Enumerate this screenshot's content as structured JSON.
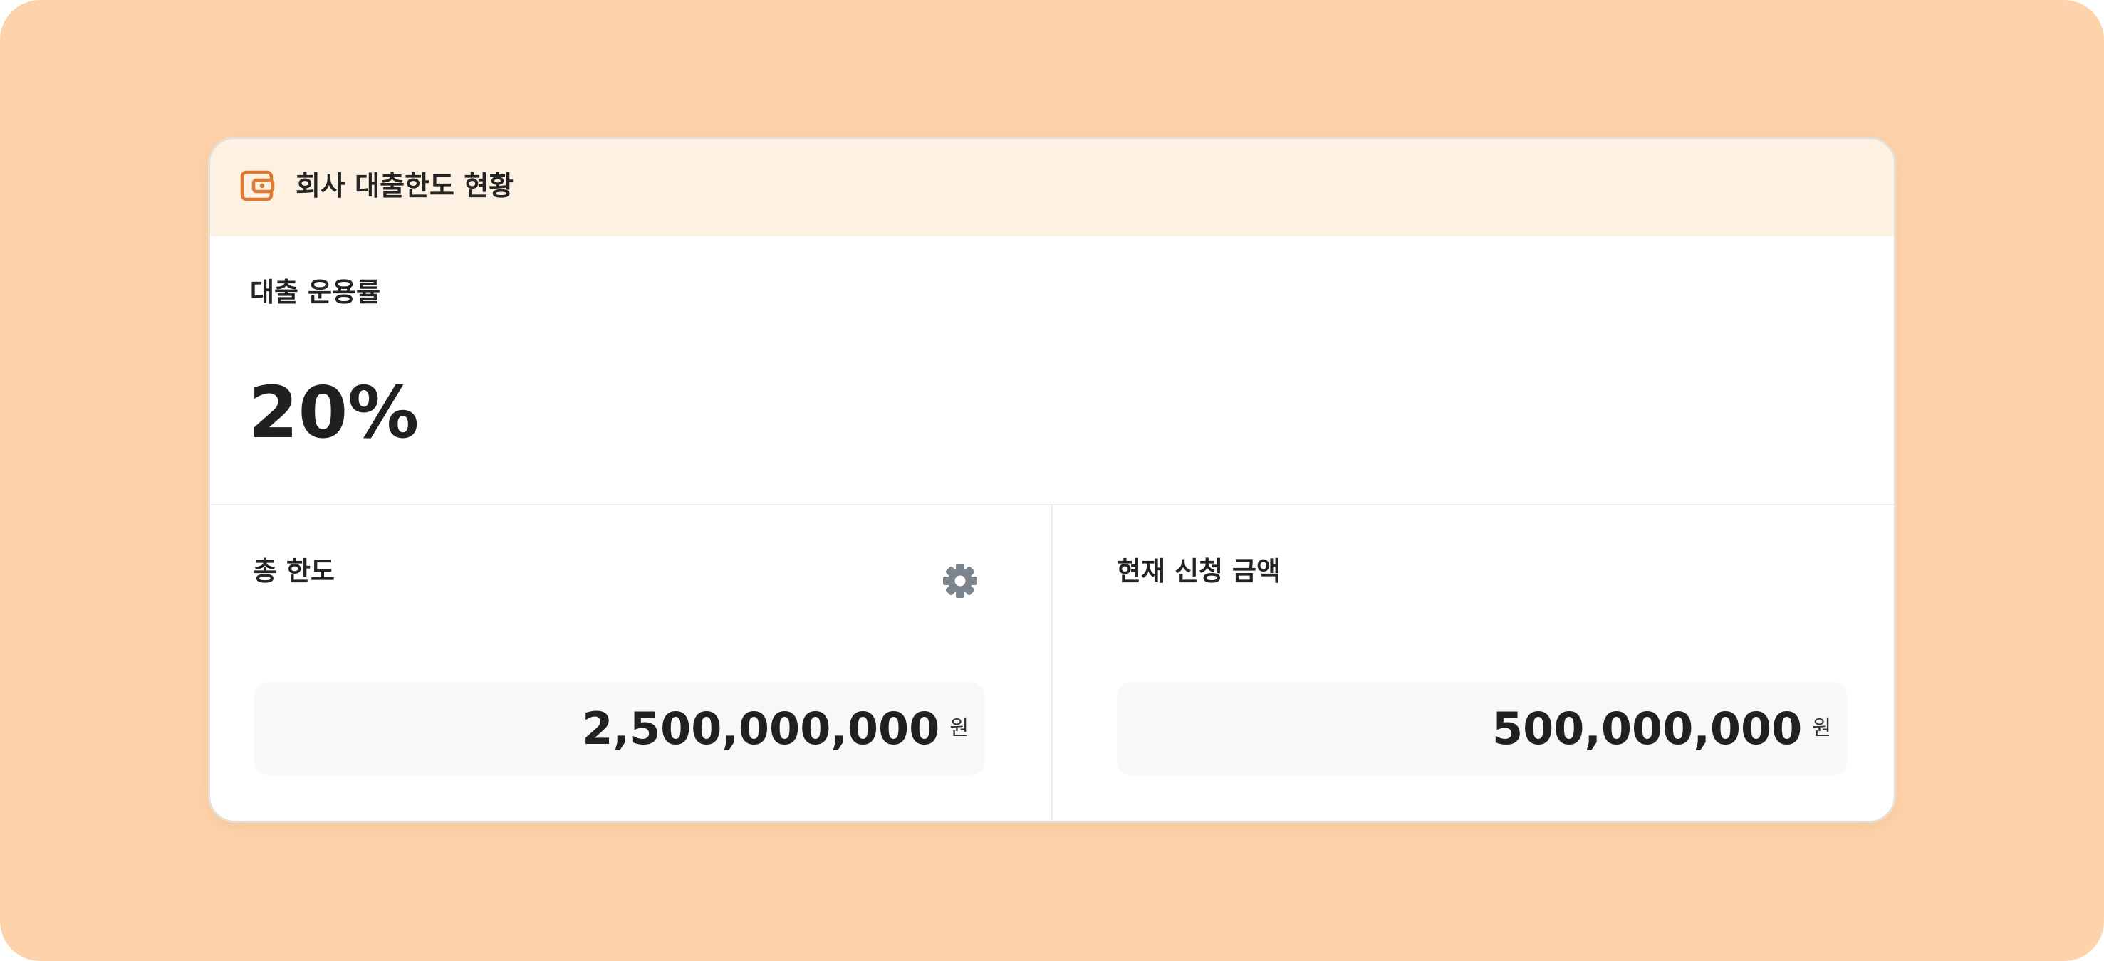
{
  "header": {
    "title": "회사 대출한도 현황",
    "icon": "wallet-icon",
    "accent_color": "#e0782f"
  },
  "utilization": {
    "label": "대출 운용률",
    "value": "20%"
  },
  "total_limit": {
    "label": "총 한도",
    "amount": "2,500,000,000",
    "unit": "원",
    "settings_icon": "gear-icon"
  },
  "current_request": {
    "label": "현재 신청 금액",
    "amount": "500,000,000",
    "unit": "원"
  },
  "colors": {
    "backdrop": "#fed3ab",
    "header_bg": "#fcf1e2",
    "amount_box_bg": "#f7f8fa",
    "gear": "#7c848e"
  }
}
